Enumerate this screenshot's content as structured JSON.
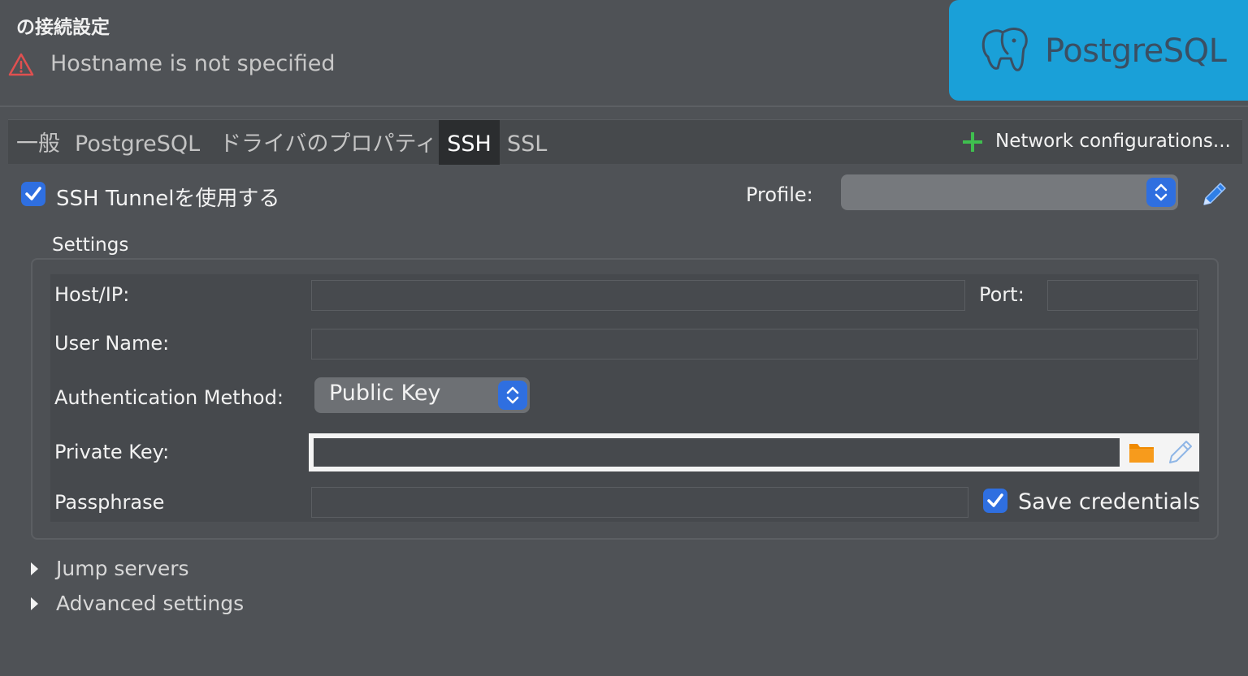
{
  "header": {
    "title": "の接続設定",
    "warning": "Hostname is not specified",
    "logo_text": "PostgreSQL"
  },
  "tabs": [
    {
      "label": "一般",
      "active": false
    },
    {
      "label": "PostgreSQL",
      "active": false
    },
    {
      "label": "ドライバのプロパティ",
      "active": false
    },
    {
      "label": "SSH",
      "active": true
    },
    {
      "label": "SSL",
      "active": false
    }
  ],
  "network_config": {
    "label": "Network configurations..."
  },
  "ssh": {
    "use_tunnel_label": "SSH Tunnelを使用する",
    "use_tunnel_checked": true,
    "profile_label": "Profile:",
    "profile_value": ""
  },
  "settings": {
    "section_label": "Settings",
    "host_label": "Host/IP:",
    "host_value": "",
    "port_label": "Port:",
    "port_value": "",
    "user_label": "User Name:",
    "user_value": "",
    "auth_label": "Authentication Method:",
    "auth_value": "Public Key",
    "private_key_label": "Private Key:",
    "private_key_value": "",
    "passphrase_label": "Passphrase",
    "passphrase_value": "",
    "save_credentials_label": "Save credentials",
    "save_credentials_checked": true
  },
  "expanders": {
    "jump_servers": "Jump servers",
    "advanced_settings": "Advanced settings"
  },
  "colors": {
    "background": "#4f5256",
    "accent_blue": "#2f6fe0",
    "logo_blue": "#1aa0d8",
    "warning_red": "#e05050",
    "plus_green": "#3fbf4f",
    "folder_orange": "#f08a00"
  },
  "icons": {
    "warning": "warning-triangle-icon",
    "elephant": "postgresql-elephant-icon",
    "plus": "plus-icon",
    "pencil": "pencil-icon",
    "folder": "folder-icon",
    "check": "checkmark-icon",
    "stepper": "up-down-chevron-icon",
    "disclosure": "disclosure-triangle-icon"
  }
}
